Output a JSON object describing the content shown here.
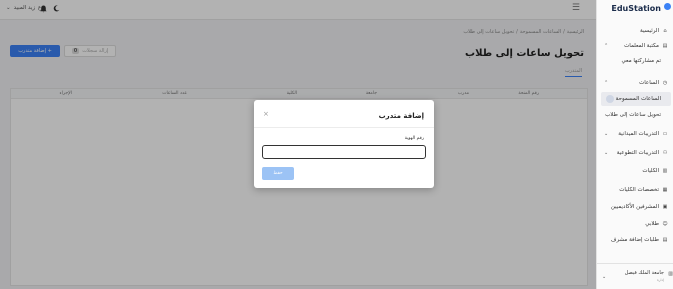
{
  "topbar": {
    "user_name": "زيد المبيد",
    "user_initial": "ع",
    "user_chevron": "⌄",
    "notification_icon": "bell-icon",
    "theme_icon": "moon-icon",
    "menu_icon": "hamburger-icon"
  },
  "breadcrumb": [
    "الرئيسية",
    "/",
    "الساعات المسموحة",
    "/",
    "تحويل ساعات إلى طلاب"
  ],
  "page": {
    "title": "تحويل ساعات إلى طلاب",
    "add_button": "إضافة متدرب +",
    "delete_button": "إزالة سجلات",
    "selected_count": "0",
    "active_tab": "المتدرب"
  },
  "table": {
    "headers": [
      "رقم المنحة",
      "مدرب",
      "جامعة",
      "الكلية",
      "عدد الساعات",
      "الإجراء"
    ]
  },
  "modal": {
    "title": "إضافة متدرب",
    "close_icon": "×",
    "field_label": "رقم الهوية",
    "field_value": "",
    "save_button": "حفظ"
  },
  "sidebar": {
    "brand": "EduStation",
    "items": [
      {
        "label": "الرئيسية",
        "icon": "home-icon",
        "arrow": ""
      },
      {
        "label": "مكتبة المعلمات",
        "icon": "book-icon",
        "arrow": "⌃"
      },
      {
        "label": "تم مشاركتها معي",
        "icon": "",
        "arrow": ""
      },
      {
        "label": "الساعات",
        "icon": "clock-icon",
        "arrow": "⌃"
      },
      {
        "label": "الساعات المسموحة",
        "icon": "",
        "arrow": ""
      },
      {
        "label": "تحويل ساعات إلى طلاب",
        "icon": "",
        "arrow": ""
      },
      {
        "label": "التدريبات الميدانية",
        "icon": "clipboard-icon",
        "arrow": "⌄"
      },
      {
        "label": "التدريبات التطوعية",
        "icon": "users-icon",
        "arrow": "⌄"
      },
      {
        "label": "الكليات",
        "icon": "building-icon",
        "arrow": ""
      },
      {
        "label": "تخصصات الكليات",
        "icon": "grid-icon",
        "arrow": ""
      },
      {
        "label": "المشرفين الأكاديميين",
        "icon": "user-tie-icon",
        "arrow": ""
      },
      {
        "label": "طلابي",
        "icon": "student-icon",
        "arrow": ""
      },
      {
        "label": "طلبات إضافة مشرف",
        "icon": "request-icon",
        "arrow": ""
      }
    ],
    "university": {
      "name": "جامعة الملك فيصل",
      "sub": "إدارة",
      "arrow": "⌄"
    }
  },
  "colors": {
    "primary": "#3b82f6",
    "save_disabled": "#9cc3f5",
    "sidebar_active": "#e9eaee"
  }
}
